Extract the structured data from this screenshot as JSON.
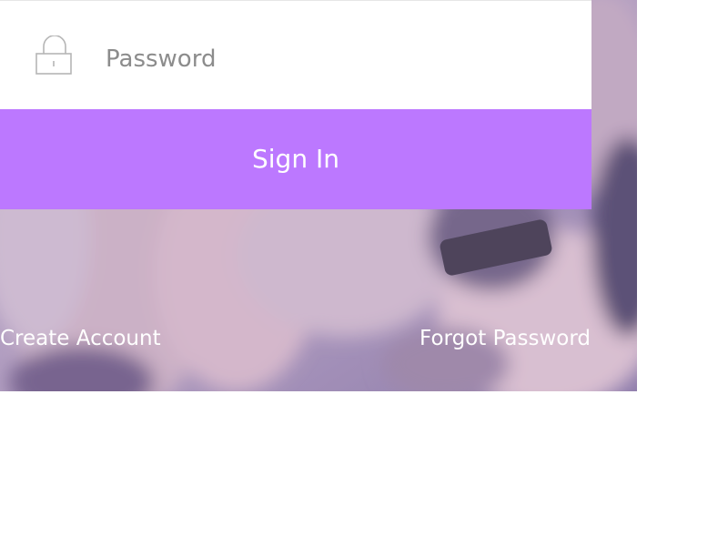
{
  "login": {
    "password_placeholder": "Password",
    "password_value": "",
    "signin_label": "Sign In",
    "create_account_label": "Create Account",
    "forgot_password_label": "Forgot Password"
  },
  "icons": {
    "password": "lock-icon"
  },
  "colors": {
    "accent": "#bc78ff",
    "input_background": "#ffffff",
    "placeholder_text": "#8c8c8c",
    "link_text": "#ffffff",
    "page_background": "#ffffff"
  }
}
